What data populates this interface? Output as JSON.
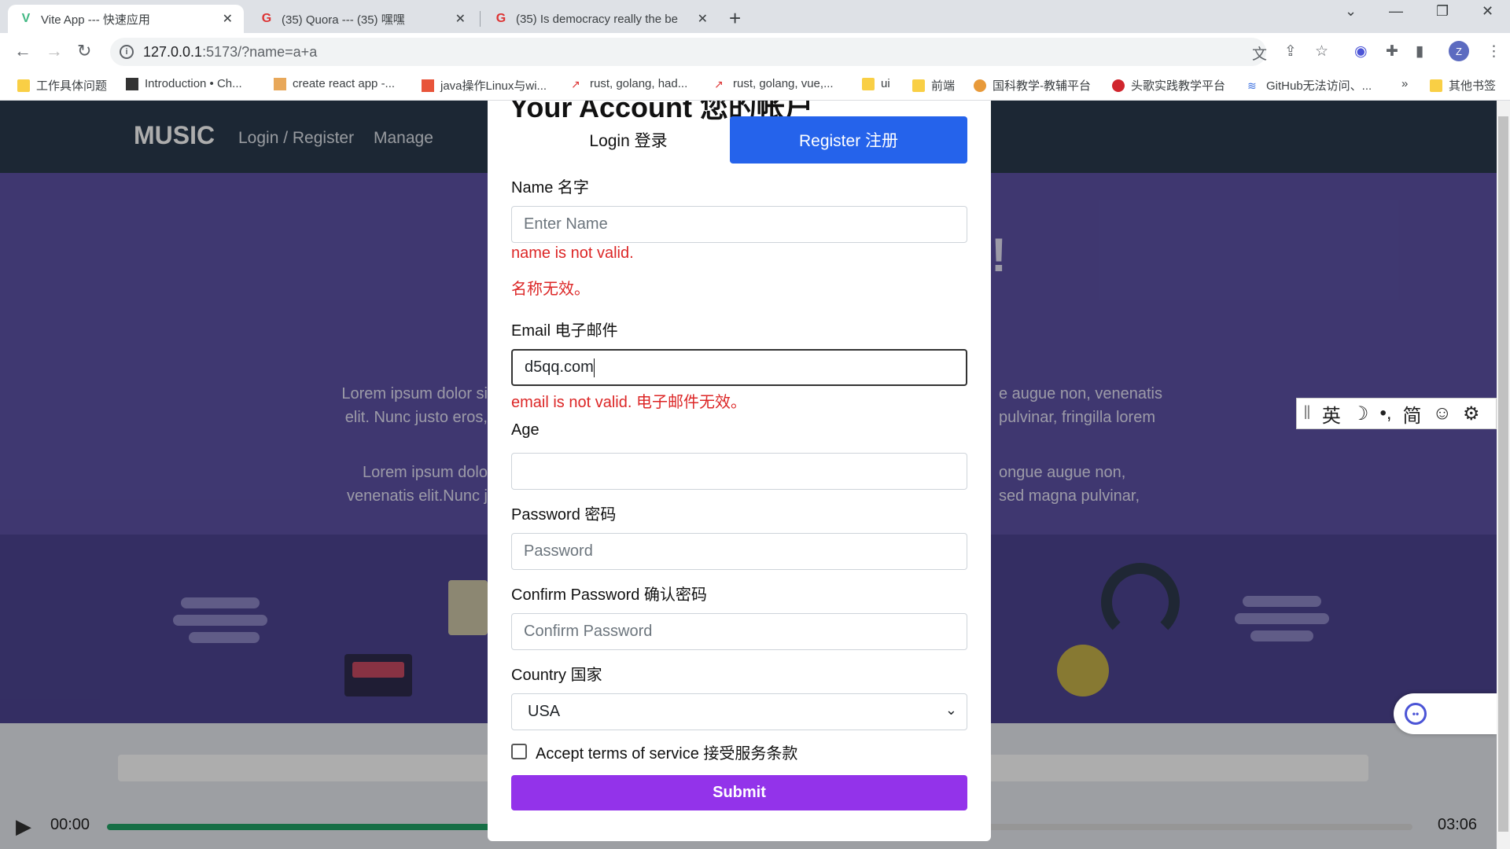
{
  "browser": {
    "tabs": [
      {
        "title": "Vite App --- 快速应用",
        "favicon": "vite-icon"
      },
      {
        "title": "(35) Quora ---  (35)  嘿嘿",
        "favicon": "quora-icon"
      },
      {
        "title": "(35) Is democracy really the be",
        "favicon": "quora-icon"
      }
    ],
    "url_host": "127.0.0.1",
    "url_rest": ":5173/?name=a+a",
    "avatar_letter": "Z",
    "bookmarks": [
      {
        "label": "工作具体问题",
        "icon": "folder-icon"
      },
      {
        "label": "Introduction • Ch...",
        "icon": "site-icon"
      },
      {
        "label": "create react app -...",
        "icon": "site-icon"
      },
      {
        "label": "java操作Linux与wi...",
        "icon": "site-icon"
      },
      {
        "label": "rust, golang, had...",
        "icon": "trend-icon"
      },
      {
        "label": "rust, golang, vue,...",
        "icon": "trend-icon"
      },
      {
        "label": "ui",
        "icon": "folder-icon"
      },
      {
        "label": "前端",
        "icon": "folder-icon"
      },
      {
        "label": "国科教学-教辅平台",
        "icon": "site-icon"
      },
      {
        "label": "头歌实践教学平台",
        "icon": "site-icon"
      },
      {
        "label": "GitHub无法访问、...",
        "icon": "site-icon"
      }
    ],
    "more_bookmarks": "»",
    "other_bookmarks": "其他书签"
  },
  "site": {
    "logo": "MUSIC",
    "nav": [
      "Login / Register",
      "Manage"
    ],
    "hero_lines": [
      "Lorem ipsum dolor si",
      "elit. Nunc justo eros,",
      "Lorem ipsum dolo",
      "venenatis elit.Nunc j",
      "e augue non, venenatis",
      "pulvinar, fringilla lorem",
      "ongue augue non,",
      "sed magna pulvinar,"
    ],
    "hero_exclaim": "!",
    "player": {
      "current": "00:00",
      "duration": "03:06",
      "progress": 0.3
    }
  },
  "ime_toolbar": [
    "英",
    "☽",
    "•,",
    "简",
    "☺",
    "⚙"
  ],
  "modal": {
    "title": "Your Account 您的帐户",
    "tabs": {
      "login": "Login 登录",
      "register": "Register 注册"
    },
    "name_label": "Name 名字",
    "name_placeholder": "Enter Name",
    "name_error_en": "name is not valid.",
    "name_error_zh": "名称无效。",
    "email_label": "Email 电子邮件",
    "email_value": "d5qq.com",
    "email_error": "email is not valid. 电子邮件无效。",
    "age_label": "Age",
    "age_value": "",
    "password_label": "Password 密码",
    "password_placeholder": "Password",
    "confirm_label": "Confirm Password 确认密码",
    "confirm_placeholder": "Confirm Password",
    "country_label": "Country 国家",
    "country_value": "USA",
    "terms_label": "Accept terms of service 接受服务条款",
    "submit_label": "Submit"
  }
}
